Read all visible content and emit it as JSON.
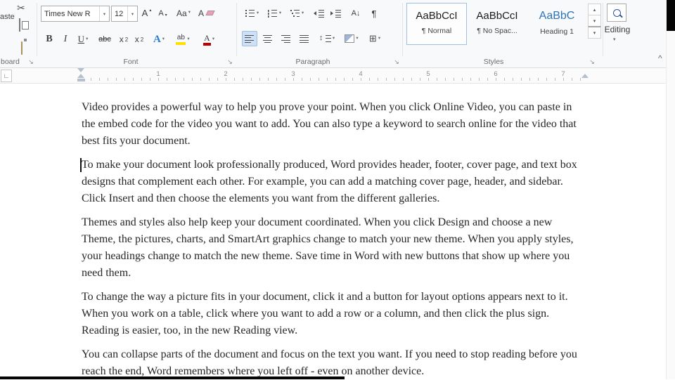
{
  "icons": {
    "scissors": "✂",
    "pilcrow": "¶",
    "borders_grid": "⊞",
    "up_arrow": "▴",
    "down_arrow": "▾",
    "more_arrow": "▾",
    "collapse_chevron": "^",
    "tab_stop": "∟",
    "launcher": "↘",
    "dropdown": "▾"
  },
  "ribbon": {
    "clipboard": {
      "paste_label": "aste",
      "group_label": "board"
    },
    "font": {
      "group_label": "Font",
      "name_value": "Times New R",
      "size_value": "12",
      "grow": "A",
      "shrink": "A",
      "change_case": "Aa",
      "clear": "A",
      "bold": "B",
      "italic": "I",
      "underline": "U",
      "strikethrough": "abc",
      "sub_base": "x",
      "sub_mark": "2",
      "sup_base": "x",
      "sup_mark": "2",
      "text_effects": "A",
      "highlight": "ab",
      "font_color": "A",
      "highlight_color": "#ffe000",
      "font_color_swatch": "#c00000"
    },
    "paragraph": {
      "group_label": "Paragraph",
      "sort": "A↓"
    },
    "styles": {
      "group_label": "Styles",
      "items": [
        {
          "sample": "AaBbCcI",
          "name": "¶ Normal"
        },
        {
          "sample": "AaBbCcI",
          "name": "¶ No Spac..."
        },
        {
          "sample": "AaBbC",
          "name": "Heading 1"
        }
      ]
    },
    "editing": {
      "label": "Editing"
    }
  },
  "ruler": {
    "marks": [
      "1",
      "2",
      "3",
      "4",
      "5",
      "6",
      "7"
    ]
  },
  "document": {
    "paragraphs": [
      "Video provides a powerful way to help you prove your point. When you click Online Video, you can paste in the embed code for the video you want to add. You can also type a keyword to search online for the video that best fits your document.",
      "To make your document look professionally produced, Word provides header, footer, cover page, and text box designs that complement each other. For example, you can add a matching cover page, header, and sidebar. Click Insert and then choose the elements you want from the different galleries.",
      "Themes and styles also help keep your document coordinated. When you click Design and choose a new Theme, the pictures, charts, and SmartArt graphics change to match your new theme. When you apply styles, your headings change to match the new theme. Save time in Word with new buttons that show up where you need them.",
      "To change the way a picture fits in your document, click it and a button for layout options appears next to it. When you work on a table, click where you want to add a row or a column, and then click the plus sign. Reading is easier, too, in the new Reading view.",
      "You can collapse parts of the document and focus on the text you want. If you need to stop reading before you reach the end, Word remembers where you left off - even on another device."
    ]
  }
}
